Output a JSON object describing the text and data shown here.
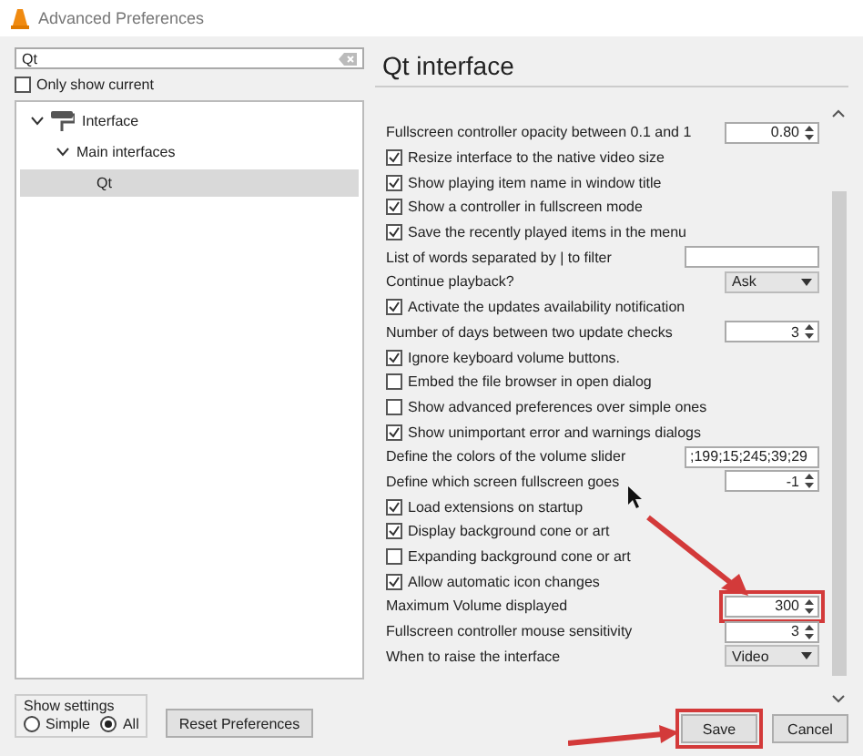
{
  "window": {
    "title": "Advanced Preferences"
  },
  "search": {
    "value": "Qt"
  },
  "only_show_current": {
    "label": "Only show current",
    "checked": false
  },
  "tree": [
    {
      "label": "Interface",
      "expanded": true,
      "selected": false,
      "children": [
        {
          "label": "Main interfaces",
          "expanded": true,
          "selected": false,
          "children": [
            {
              "label": "Qt",
              "selected": true
            }
          ]
        }
      ]
    }
  ],
  "show_settings": {
    "title": "Show settings",
    "options": [
      {
        "label": "Simple",
        "selected": false
      },
      {
        "label": "All",
        "selected": true
      }
    ]
  },
  "reset_button": "Reset Preferences",
  "panel_title": "Qt interface",
  "settings": [
    {
      "kind": "spin",
      "label": "Fullscreen controller opacity between 0.1 and 1",
      "value": "0.80",
      "annotated": false
    },
    {
      "kind": "check",
      "label": "Resize interface to the native video size",
      "checked": true
    },
    {
      "kind": "check",
      "label": "Show playing item name in window title",
      "checked": true
    },
    {
      "kind": "check",
      "label": "Show a controller in fullscreen mode",
      "checked": true
    },
    {
      "kind": "check",
      "label": "Save the recently played items in the menu",
      "checked": true
    },
    {
      "kind": "text",
      "label": "List of words separated by | to filter"
    },
    {
      "kind": "dropdown",
      "label": "Continue playback?",
      "value": "Ask"
    },
    {
      "kind": "check",
      "label": "Activate the updates availability notification",
      "checked": true
    },
    {
      "kind": "spin",
      "label": "Number of days between two update checks",
      "value": "3",
      "annotated": false
    },
    {
      "kind": "check",
      "label": "Ignore keyboard volume buttons.",
      "checked": true
    },
    {
      "kind": "check",
      "label": "Embed the file browser in open dialog",
      "checked": false
    },
    {
      "kind": "check",
      "label": "Show advanced preferences over simple ones",
      "checked": false
    },
    {
      "kind": "check",
      "label": "Show unimportant error and warnings dialogs",
      "checked": true
    },
    {
      "kind": "text",
      "label": "Define the colors of the volume slider",
      "value": ";199;15;245;39;29"
    },
    {
      "kind": "spin",
      "label": "Define which screen fullscreen goes",
      "value": "-1",
      "annotated": false
    },
    {
      "kind": "check",
      "label": "Load extensions on startup",
      "checked": true
    },
    {
      "kind": "check",
      "label": "Display background cone or art",
      "checked": true
    },
    {
      "kind": "check",
      "label": "Expanding background cone or art",
      "checked": false
    },
    {
      "kind": "check",
      "label": "Allow automatic icon changes",
      "checked": true
    },
    {
      "kind": "spin",
      "label": "Maximum Volume displayed",
      "value": "300",
      "annotated": true
    },
    {
      "kind": "spin",
      "label": "Fullscreen controller mouse sensitivity",
      "value": "3",
      "annotated": false
    },
    {
      "kind": "dropdown",
      "label": "When to raise the interface",
      "value": "Video"
    }
  ],
  "buttons": [
    {
      "label": "Save",
      "annotated": true
    },
    {
      "label": "Cancel",
      "annotated": false
    }
  ]
}
